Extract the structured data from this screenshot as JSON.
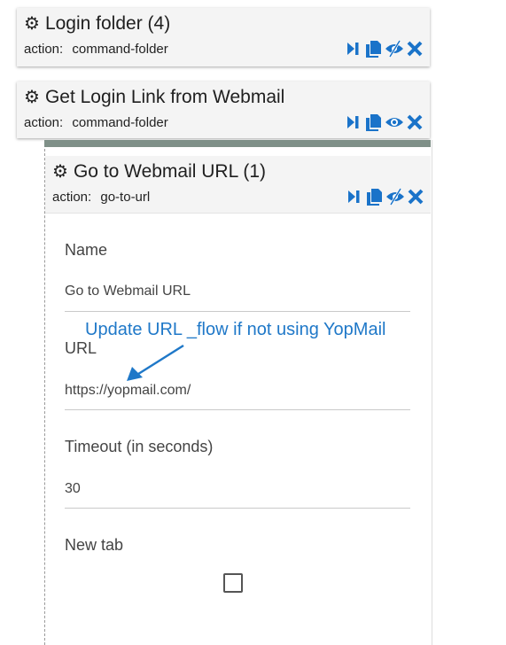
{
  "card1": {
    "title": "Login folder (4)",
    "action_key": "action:",
    "action_value": "command-folder"
  },
  "card2": {
    "title": "Get Login Link from Webmail",
    "action_key": "action:",
    "action_value": "command-folder"
  },
  "card3": {
    "title": "Go to Webmail URL (1)",
    "action_key": "action:",
    "action_value": "go-to-url"
  },
  "form": {
    "name_label": "Name",
    "name_value": "Go to Webmail URL",
    "url_label": "URL",
    "url_value": "https://yopmail.com/",
    "timeout_label": "Timeout (in seconds)",
    "timeout_value": "30",
    "new_tab_label": "New tab",
    "new_tab_checked": false
  },
  "annotation": "Update URL _flow if not using YopMail",
  "icons": [
    "run-to-here-icon",
    "copy-icon",
    "toggle-visibility-icon",
    "delete-icon"
  ],
  "colors": {
    "icon_blue": "#1a73c9",
    "annotation_blue": "#1f78c8",
    "divider_bar": "#7f9088"
  }
}
